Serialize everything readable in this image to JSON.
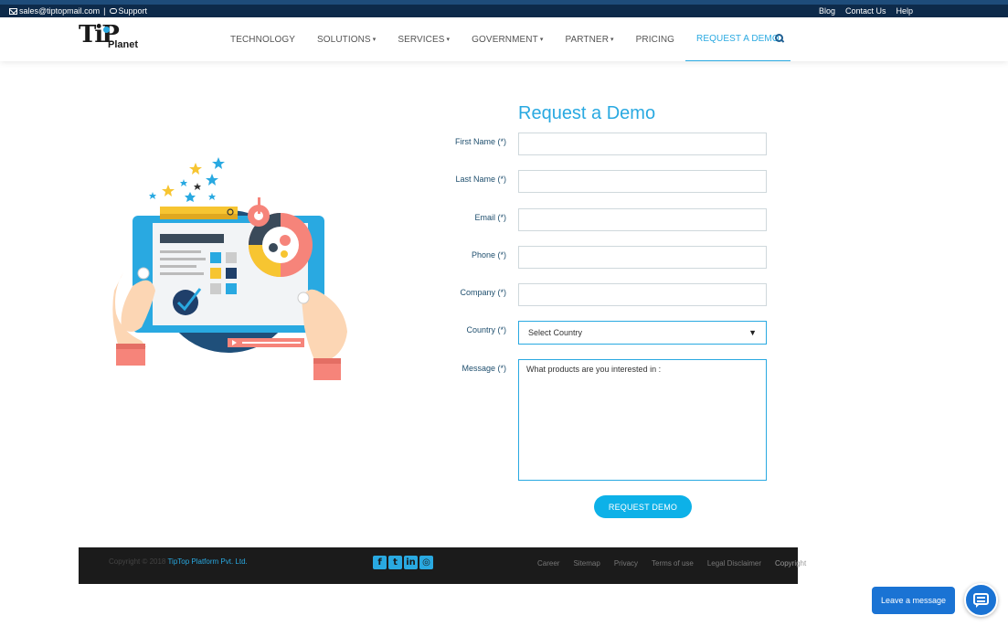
{
  "topbar": {
    "email": "sales@tiptopmail.com",
    "separator": "|",
    "support": "Support",
    "links": [
      "Blog",
      "Contact Us",
      "Help"
    ]
  },
  "header": {
    "logo_main": "TiP",
    "logo_sub": "Planet",
    "nav": [
      {
        "label": "TECHNOLOGY",
        "dropdown": false
      },
      {
        "label": "SOLUTIONS",
        "dropdown": true
      },
      {
        "label": "SERVICES",
        "dropdown": true
      },
      {
        "label": "GOVERNMENT",
        "dropdown": true
      },
      {
        "label": "PARTNER",
        "dropdown": true
      },
      {
        "label": "PRICING",
        "dropdown": false
      },
      {
        "label": "REQUEST A DEMO",
        "dropdown": false,
        "active": true
      }
    ],
    "caret": "▾"
  },
  "form": {
    "title": "Request a Demo",
    "fields": {
      "first_name": {
        "label": "First Name (*)",
        "value": ""
      },
      "last_name": {
        "label": "Last Name (*)",
        "value": ""
      },
      "email": {
        "label": "Email (*)",
        "value": ""
      },
      "phone": {
        "label": "Phone (*)",
        "value": ""
      },
      "company": {
        "label": "Company (*)",
        "value": ""
      },
      "country": {
        "label": "Country (*)",
        "value": "Select Country"
      },
      "message": {
        "label": "Message (*)",
        "value": "What products are you interested in :"
      }
    },
    "submit_label": "REQUEST DEMO"
  },
  "footer": {
    "copyright_prefix": "Copyright © 2018",
    "company": "TipTop Platform Pvt. Ltd.",
    "social": [
      "facebook-icon",
      "twitter-icon",
      "linkedin-icon",
      "instagram-icon"
    ],
    "links": [
      "Career",
      "Sitemap",
      "Privacy",
      "Terms of use",
      "Legal Disclaimer"
    ],
    "trailing": "Copyright"
  },
  "chat": {
    "label": "Leave a message"
  },
  "colors": {
    "accent": "#29a9e1",
    "button": "#0db1e8",
    "topbar": "#0d2a4a",
    "footer": "#1b1b1b",
    "chat": "#1a73d4"
  }
}
